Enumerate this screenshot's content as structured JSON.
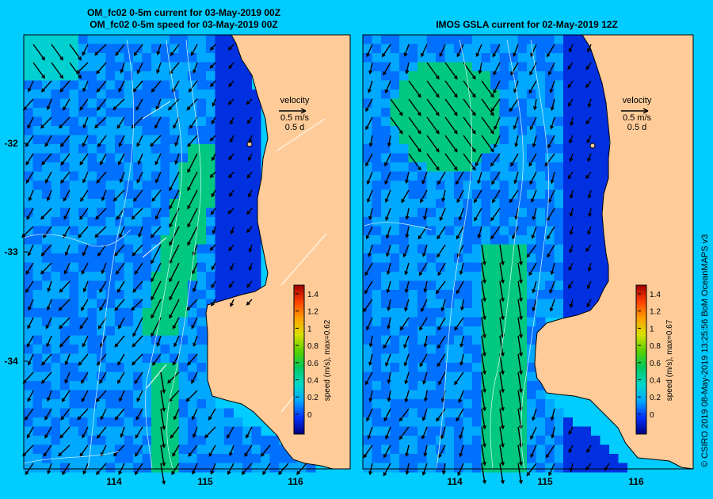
{
  "left_panel": {
    "title_line1": "OM_fc02 0-5m current for 03-May-2019 00Z",
    "title_line2": "OM_fc02 0-5m speed for 03-May-2019 00Z",
    "velocity_label": "velocity",
    "velocity_scale_speed": "0.5 m/s",
    "velocity_scale_time": "0.5 d",
    "colorbar_label": "speed (m/s), max=0.62"
  },
  "right_panel": {
    "title": "IMOS GSLA current for 02-May-2019 12Z",
    "velocity_label": "velocity",
    "velocity_scale_speed": "0.5 m/s",
    "velocity_scale_time": "0.5 d",
    "colorbar_label": "speed (m/s), max=0.67"
  },
  "axes": {
    "lat_ticks": [
      "-32",
      "-33",
      "-34"
    ],
    "lon_ticks_left": [
      "114",
      "115",
      "116"
    ],
    "lon_ticks_right": [
      "114",
      "115",
      "116"
    ]
  },
  "colorbar": {
    "ticks": [
      "1.4",
      "1.2",
      "1",
      "0.8",
      "0.6",
      "0.4",
      "0.2",
      "0"
    ],
    "colors": [
      "#000080",
      "#0030ff",
      "#00a8ff",
      "#00d8c8",
      "#00c860",
      "#58d000",
      "#d8e000",
      "#ffa000",
      "#ff4000",
      "#a00000"
    ]
  },
  "credit": "© CSIRO 2019   08-May-2019 13:25:56 BoM OceanMAPS v3",
  "colors": {
    "background": "#00ccff",
    "land": "#ffcc99",
    "coast": "#000000"
  }
}
